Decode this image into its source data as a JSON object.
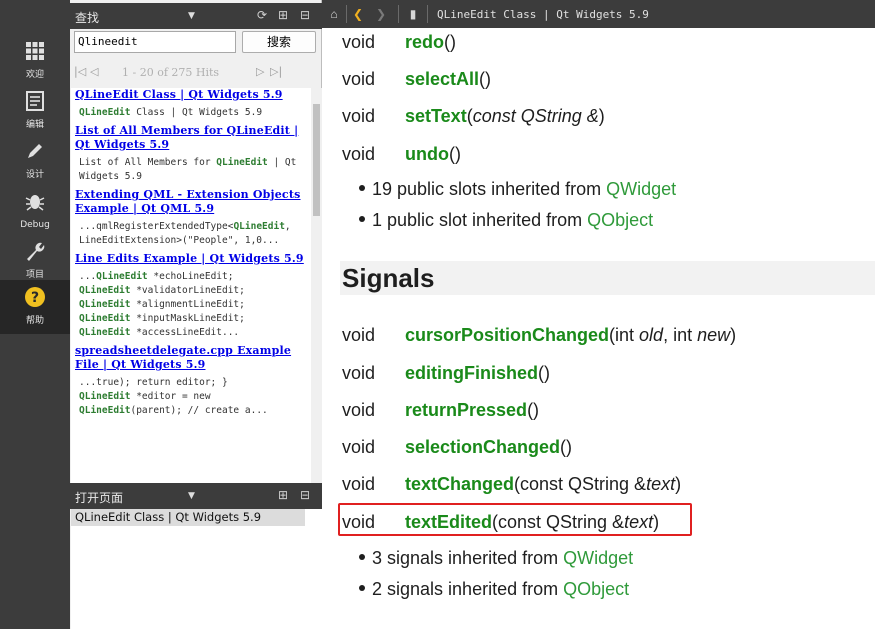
{
  "modebar": {
    "items": [
      {
        "label": "欢迎",
        "icon": "grid-icon"
      },
      {
        "label": "编辑",
        "icon": "document-icon"
      },
      {
        "label": "设计",
        "icon": "pen-icon"
      },
      {
        "label": "Debug",
        "icon": "bug-icon"
      },
      {
        "label": "项目",
        "icon": "wrench-icon"
      },
      {
        "label": "帮助",
        "icon": "help-icon"
      }
    ],
    "active": "帮助"
  },
  "search_pane": {
    "title": "查找",
    "query": "Qlineedit",
    "search_button": "搜索",
    "pager_text": "1 - 20 of 275 Hits",
    "results": [
      {
        "title": "QLineEdit Class | Qt Widgets 5.9",
        "snippet": [
          "QLineEdit",
          " Class | Qt Widgets 5.9"
        ]
      },
      {
        "title": "List of All Members for QLineEdit | Qt Widgets 5.9",
        "snippet": [
          "List of All Members for ",
          "QLineEdit",
          " | Qt Widgets 5.9"
        ]
      },
      {
        "title": "Extending QML - Extension Objects Example | Qt QML 5.9",
        "snippet": [
          "...qmlRegisterExtendedType<",
          "QLineEdit",
          ", LineEditExtension>(\"People\", 1,0..."
        ]
      },
      {
        "title": "Line Edits Example | Qt Widgets 5.9",
        "snippet_lines": [
          [
            "...",
            "QLineEdit",
            " *echoLineEdit;"
          ],
          [
            "",
            "QLineEdit",
            " *validatorLineEdit;"
          ],
          [
            "",
            "QLineEdit",
            " *alignmentLineEdit;"
          ],
          [
            "",
            "QLineEdit",
            " *inputMaskLineEdit;"
          ],
          [
            "",
            "QLineEdit",
            " *accessLineEdit..."
          ]
        ]
      },
      {
        "title": "spreadsheetdelegate.cpp Example File | Qt Widgets 5.9",
        "snippet_lines": [
          [
            "...true); return editor; }",
            "",
            ""
          ],
          [
            "",
            "QLineEdit",
            " *editor = new"
          ],
          [
            "",
            "QLineEdit",
            "(parent); // create a..."
          ]
        ]
      }
    ]
  },
  "open_pages": {
    "title": "打开页面",
    "items": [
      "QLineEdit Class | Qt Widgets 5.9"
    ]
  },
  "doc": {
    "tab_title": "QLineEdit Class | Qt Widgets 5.9",
    "slots": [
      {
        "ret": "void",
        "name": "redo",
        "args": "()"
      },
      {
        "ret": "void",
        "name": "selectAll",
        "args": "()"
      },
      {
        "ret": "void",
        "name": "setText",
        "args_italic": "const QString &",
        "args_pre": "(",
        "args_post": ")"
      },
      {
        "ret": "void",
        "name": "undo",
        "args": "()"
      }
    ],
    "slot_inherited": [
      {
        "text": "19 public slots inherited from ",
        "link": "QWidget"
      },
      {
        "text": "1 public slot inherited from ",
        "link": "QObject"
      }
    ],
    "signals_heading": "Signals",
    "signals": [
      {
        "ret": "void",
        "name": "cursorPositionChanged",
        "a1": "(int ",
        "a2": "old",
        "a3": ", int ",
        "a4": "new",
        "a5": ")"
      },
      {
        "ret": "void",
        "name": "editingFinished",
        "a1": "()",
        "a2": "",
        "a3": "",
        "a4": "",
        "a5": ""
      },
      {
        "ret": "void",
        "name": "returnPressed",
        "a1": "()",
        "a2": "",
        "a3": "",
        "a4": "",
        "a5": ""
      },
      {
        "ret": "void",
        "name": "selectionChanged",
        "a1": "()",
        "a2": "",
        "a3": "",
        "a4": "",
        "a5": ""
      },
      {
        "ret": "void",
        "name": "textChanged",
        "a1": "(const QString &",
        "a2": "text",
        "a3": ")",
        "a4": "",
        "a5": ""
      },
      {
        "ret": "void",
        "name": "textEdited",
        "a1": "(const QString &",
        "a2": "text",
        "a3": ")",
        "a4": "",
        "a5": ""
      }
    ],
    "signal_inherited": [
      {
        "text": "3 signals inherited from ",
        "link": "QWidget"
      },
      {
        "text": "2 signals inherited from ",
        "link": "QObject"
      }
    ],
    "highlight_color": "#e02020",
    "function_color": "#1a8a1a"
  }
}
